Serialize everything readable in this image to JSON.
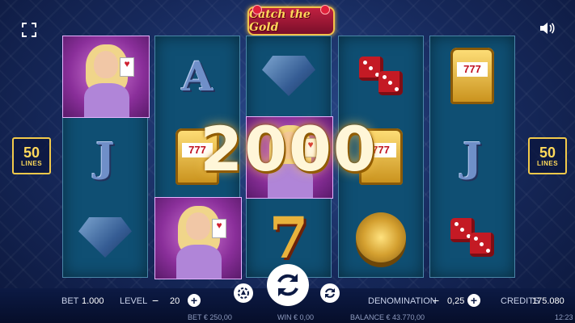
{
  "logo": {
    "text": "Catch the Gold"
  },
  "win": {
    "amount": "2000"
  },
  "lines": {
    "count": "50",
    "label": "LINES"
  },
  "reels": [
    [
      "lady",
      "J",
      "gem"
    ],
    [
      "A",
      "slot",
      "lady"
    ],
    [
      "gem",
      "lady",
      "seven"
    ],
    [
      "dice",
      "slot",
      "chips"
    ],
    [
      "slot",
      "J",
      "dice"
    ]
  ],
  "controls": {
    "bet_label": "BET",
    "bet_value": "1.000",
    "level_label": "LEVEL",
    "level_value": "20",
    "denomination_label": "DENOMINATION",
    "denomination_value": "0,25",
    "credits_label": "CREDITS",
    "credits_value": "175.080",
    "minus": "−",
    "plus": "+"
  },
  "footer": {
    "bet": "BET  € 250,00",
    "win": "WIN  € 0,00",
    "balance": "BALANCE  € 43.770,00",
    "time": "12:23"
  },
  "colors": {
    "accent_gold": "#f2c94a",
    "reel_bg": "#0f4f73",
    "background": "#16285a"
  }
}
